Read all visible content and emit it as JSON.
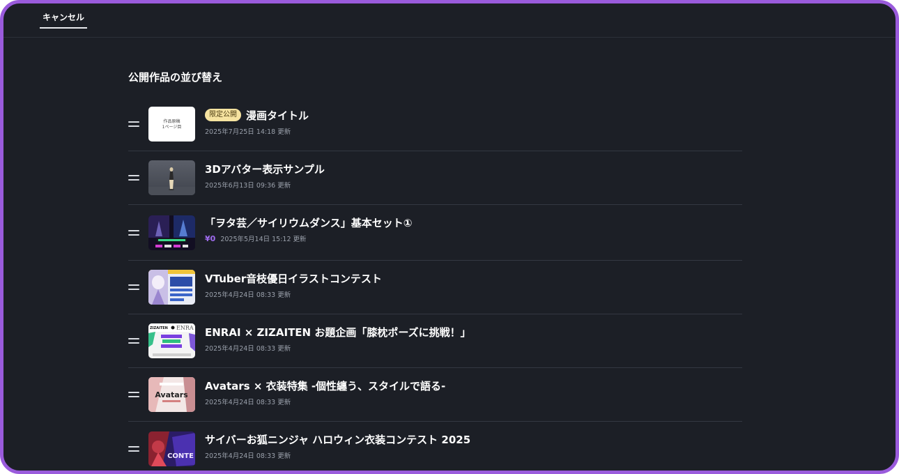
{
  "header": {
    "cancel_label": "キャンセル"
  },
  "section": {
    "title": "公開作品の並び替え"
  },
  "works": [
    {
      "badge": "限定公開",
      "title": "漫画タイトル",
      "price": "",
      "updated": "2025年7月25日 14:18 更新",
      "thumb": "manuscript",
      "thumb_text_1": "作品原稿",
      "thumb_text_2": "1ページ目"
    },
    {
      "badge": "",
      "title": "3Dアバター表示サンプル",
      "price": "",
      "updated": "2025年6月13日 09:36 更新",
      "thumb": "avatar"
    },
    {
      "badge": "",
      "title": "「ヲタ芸／サイリウムダンス」基本セット①",
      "price": "¥0",
      "updated": "2025年5月14日 15:12 更新",
      "thumb": "dance"
    },
    {
      "badge": "",
      "title": "VTuber音枝優日イラストコンテスト",
      "price": "",
      "updated": "2025年4月24日 08:33 更新",
      "thumb": "vtuber"
    },
    {
      "badge": "",
      "title": "ENRAI × ZIZAITEN お題企画「膝枕ポーズに挑戦！」",
      "price": "",
      "updated": "2025年4月24日 08:33 更新",
      "thumb": "enrai",
      "thumb_text_1": "ZIZAITEN",
      "thumb_text_2": "ENRA"
    },
    {
      "badge": "",
      "title": "Avatars × 衣装特集 -個性纏う、スタイルで語る-",
      "price": "",
      "updated": "2025年4月24日 08:33 更新",
      "thumb": "avatars",
      "thumb_text_1": "Avatars"
    },
    {
      "badge": "",
      "title": "サイバーお狐ニンジャ ハロウィン衣装コンテスト 2025",
      "price": "",
      "updated": "2025年4月24日 08:33 更新",
      "thumb": "cyber",
      "thumb_text_1": "CONTE"
    }
  ]
}
